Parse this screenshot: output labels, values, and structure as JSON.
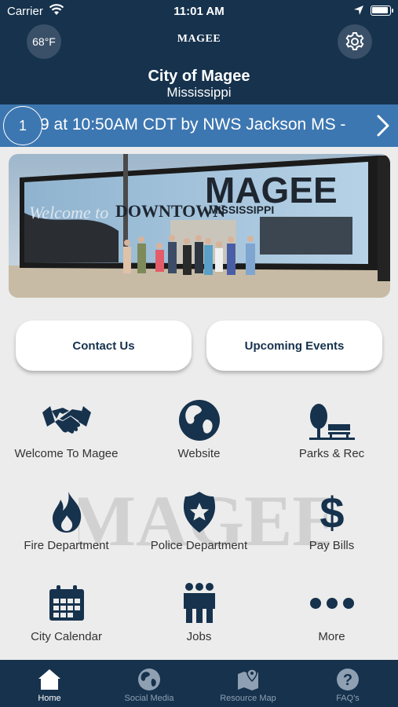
{
  "status_bar": {
    "carrier": "Carrier",
    "time": "11:01 AM"
  },
  "header": {
    "temperature": "68°F",
    "logo_text": "MAGEE",
    "city": "City of Magee",
    "state": "Mississippi"
  },
  "ticker": {
    "badge_count": "1",
    "text": "9 at 10:50AM CDT by NWS Jackson MS -"
  },
  "banner_photo": {
    "sign_top": "DOWNTOWN",
    "sign_main": "MAGEE",
    "sign_sub": "MISSISSIPPI",
    "sign_script": "Welcome to"
  },
  "buttons": {
    "contact": "Contact Us",
    "events": "Upcoming Events"
  },
  "watermark_text": "MAGEE",
  "tiles": [
    {
      "label": "Welcome To Magee",
      "icon": "handshake-icon"
    },
    {
      "label": "Website",
      "icon": "globe-icon"
    },
    {
      "label": "Parks & Rec",
      "icon": "park-bench-icon"
    },
    {
      "label": "Fire Department",
      "icon": "flame-icon"
    },
    {
      "label": "Police Department",
      "icon": "police-badge-icon"
    },
    {
      "label": "Pay Bills",
      "icon": "dollar-icon"
    },
    {
      "label": "City Calendar",
      "icon": "calendar-icon"
    },
    {
      "label": "Jobs",
      "icon": "people-icon"
    },
    {
      "label": "More",
      "icon": "more-dots-icon"
    }
  ],
  "tabbar": [
    {
      "label": "Home",
      "icon": "home-icon",
      "active": true
    },
    {
      "label": "Social Media",
      "icon": "globe-icon"
    },
    {
      "label": "Resource Map",
      "icon": "map-icon"
    },
    {
      "label": "FAQ's",
      "icon": "question-icon"
    }
  ],
  "colors": {
    "navy": "#16324d",
    "ticker_blue": "#3d77b1",
    "background": "#ececec"
  }
}
